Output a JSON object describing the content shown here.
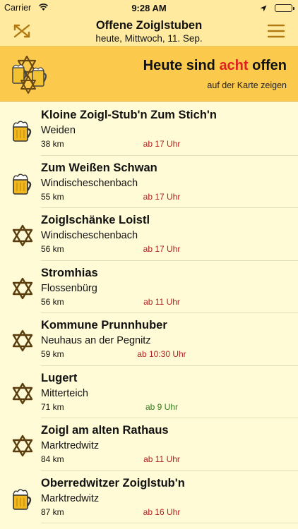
{
  "status": {
    "carrier": "Carrier",
    "time": "9:28 AM"
  },
  "header": {
    "title": "Offene Zoiglstuben",
    "subtitle": "heute, Mittwoch, 11. Sep.",
    "left_icon": "crossed-arrows-icon",
    "right_icon": "menu-icon"
  },
  "banner": {
    "headline_pre": "Heute sind ",
    "headline_count": "acht",
    "headline_post": " offen",
    "map_link": "auf der Karte zeigen",
    "accent_color": "#e02020",
    "background_color": "#fbc94c"
  },
  "items": [
    {
      "name": "Kloine Zoigl-Stub'n Zum Stich'n",
      "place": "Weiden",
      "distance": "38 km",
      "opens": "ab 17 Uhr",
      "icon": "beer-mug-icon"
    },
    {
      "name": "Zum Weißen Schwan",
      "place": "Windischeschenbach",
      "distance": "55 km",
      "opens": "ab 17 Uhr",
      "icon": "beer-mug-icon"
    },
    {
      "name": "Zoiglschänke Loistl",
      "place": "Windischeschenbach",
      "distance": "56 km",
      "opens": "ab 17 Uhr",
      "icon": "zoigl-star-icon"
    },
    {
      "name": "Stromhias",
      "place": "Flossenbürg",
      "distance": "56 km",
      "opens": "ab 11 Uhr",
      "icon": "zoigl-star-icon"
    },
    {
      "name": "Kommune Prunnhuber",
      "place": "Neuhaus an der Pegnitz",
      "distance": "59 km",
      "opens": "ab 10:30 Uhr",
      "icon": "zoigl-star-icon"
    },
    {
      "name": "Lugert",
      "place": "Mitterteich",
      "distance": "71 km",
      "opens": "ab 9 Uhr",
      "icon": "zoigl-star-icon"
    },
    {
      "name": "Zoigl am alten Rathaus",
      "place": "Marktredwitz",
      "distance": "84 km",
      "opens": "ab 11 Uhr",
      "icon": "zoigl-star-icon"
    },
    {
      "name": "Oberredwitzer Zoiglstub'n",
      "place": "Marktredwitz",
      "distance": "87 km",
      "opens": "ab 16 Uhr",
      "icon": "beer-mug-icon"
    }
  ]
}
